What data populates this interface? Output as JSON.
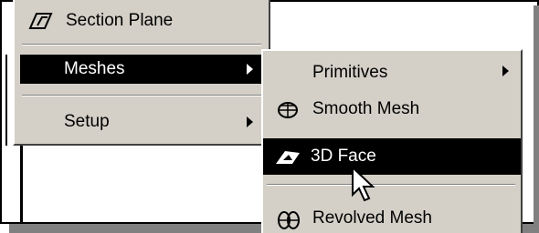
{
  "menu": {
    "items": [
      {
        "label": "Section Plane",
        "icon": "section-plane-icon"
      },
      {
        "label": "Meshes",
        "selected": true,
        "has_submenu": true
      },
      {
        "label": "Setup",
        "has_submenu": true
      }
    ]
  },
  "submenu": {
    "items": [
      {
        "label": "Primitives",
        "has_submenu": true
      },
      {
        "label": "Smooth Mesh",
        "icon": "smooth-mesh-icon"
      },
      {
        "label": "3D Face",
        "icon": "3d-face-icon",
        "selected": true
      },
      {
        "label": "Revolved Mesh",
        "icon": "revolved-mesh-icon"
      }
    ]
  },
  "colors": {
    "menu_bg": "#d4d0c8",
    "selected_bg": "#000000",
    "selected_text": "#ffffff"
  }
}
